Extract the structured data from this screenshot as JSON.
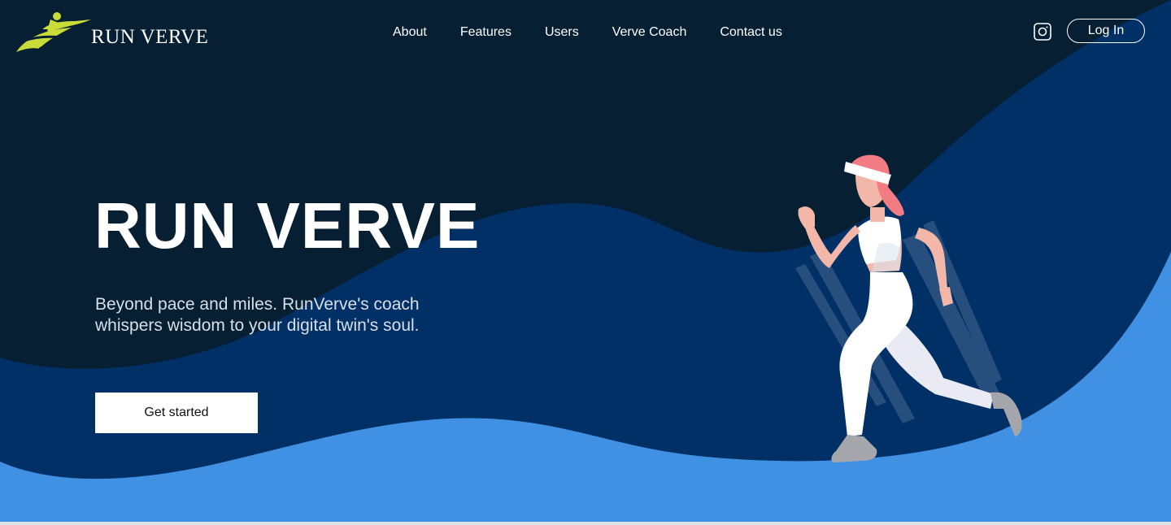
{
  "brand": {
    "name": "RUN VERVE",
    "logo_icon": "runner-swoosh-logo",
    "logo_color": "#c9dc3a"
  },
  "nav": {
    "items": [
      {
        "label": "About"
      },
      {
        "label": "Features"
      },
      {
        "label": "Users"
      },
      {
        "label": "Verve Coach"
      },
      {
        "label": "Contact us"
      }
    ]
  },
  "header": {
    "social_icon": "instagram-icon",
    "login_label": "Log In"
  },
  "hero": {
    "title": "RUN VERVE",
    "subtitle": "Beyond pace and miles. RunVerve's coach whispers wisdom to your digital twin's soul.",
    "cta_label": "Get started",
    "illustration": "running-woman-illustration"
  },
  "colors": {
    "background_dark": "#061f33",
    "wave_navy": "#003066",
    "wave_light": "#4090e3",
    "text_white": "#ffffff",
    "runner_hair": "#f27b84",
    "runner_outfit": "#f2f2f7"
  }
}
